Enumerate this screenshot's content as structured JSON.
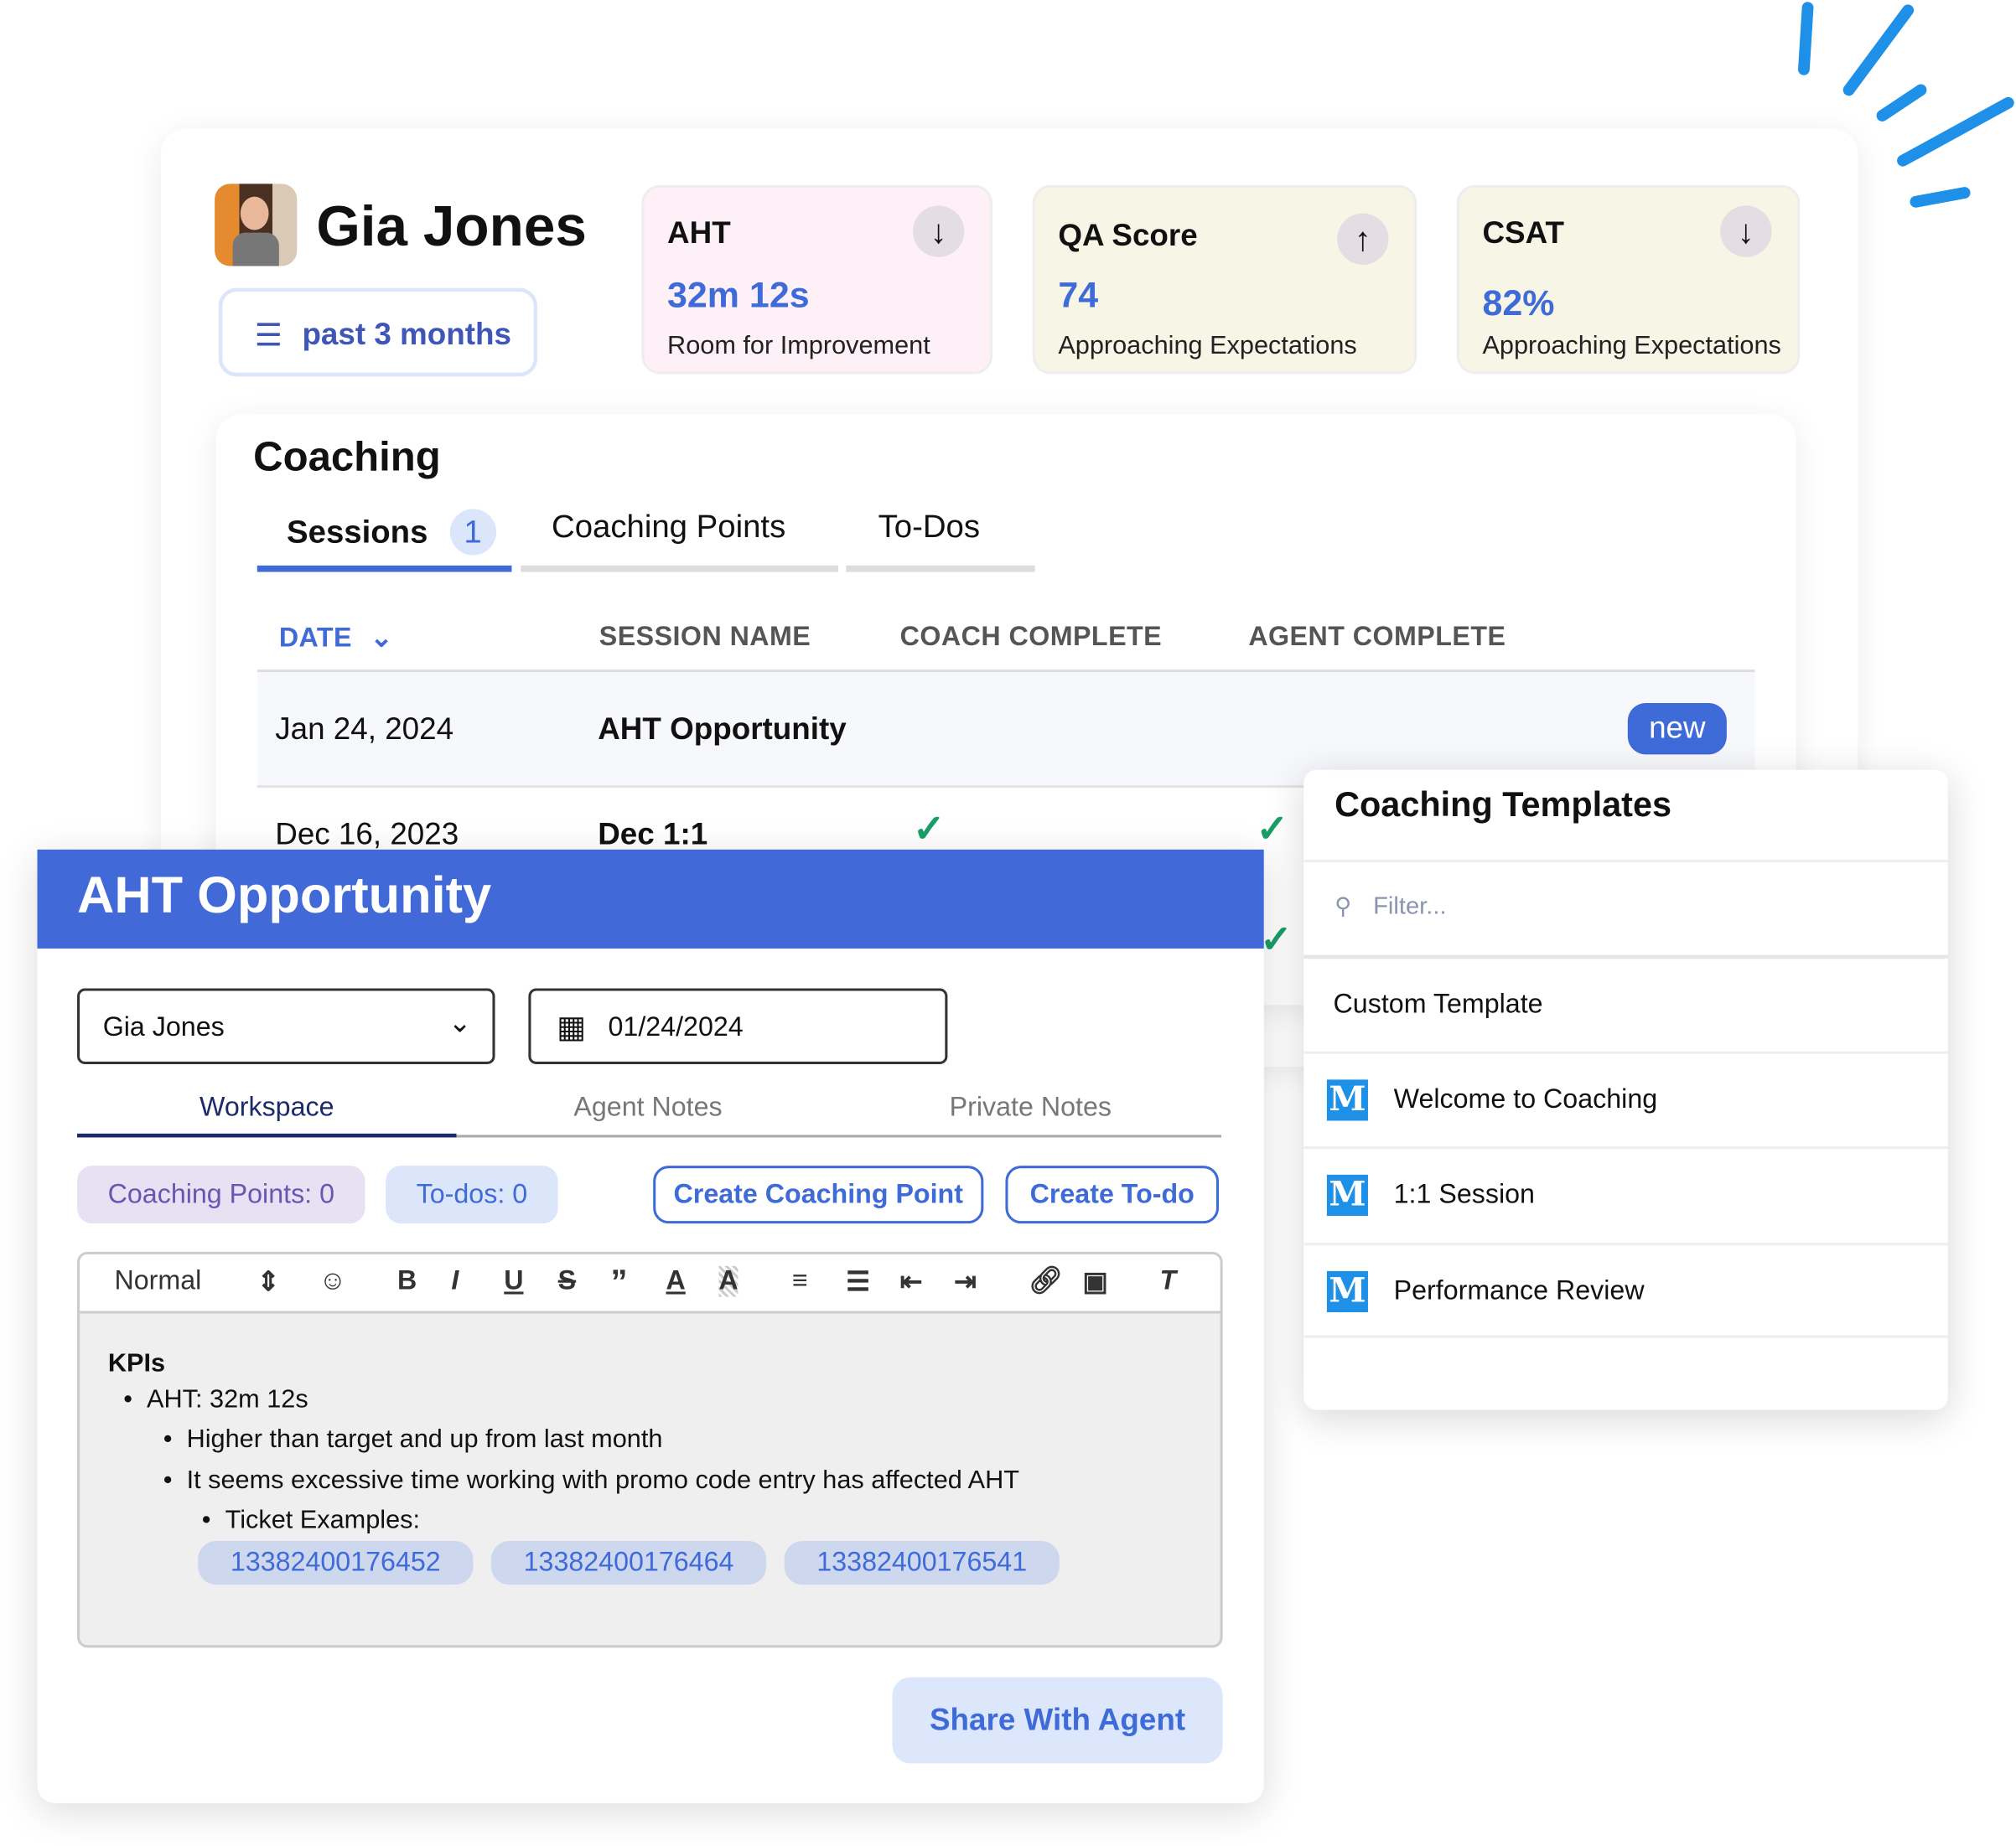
{
  "agent": {
    "name": "Gia Jones",
    "filter_label": "past 3 months"
  },
  "kpis": [
    {
      "label": "AHT",
      "value": "32m 12s",
      "status": "Room for Improvement",
      "trend": "down",
      "bg": "#fdf0f6"
    },
    {
      "label": "QA Score",
      "value": "74",
      "status": "Approaching Expectations",
      "trend": "up",
      "bg": "#f7f6e6"
    },
    {
      "label": "CSAT",
      "value": "82%",
      "status": "Approaching Expectations",
      "trend": "down",
      "bg": "#f7f6e6"
    }
  ],
  "coaching": {
    "title": "Coaching",
    "tabs": [
      {
        "label": "Sessions",
        "badge": "1"
      },
      {
        "label": "Coaching Points"
      },
      {
        "label": "To-Dos"
      }
    ],
    "columns": [
      "DATE",
      "SESSION NAME",
      "COACH COMPLETE",
      "AGENT COMPLETE"
    ],
    "rows": [
      {
        "date": "Jan 24, 2024",
        "name": "AHT Opportunity",
        "badge": "new"
      },
      {
        "date": "Dec 16, 2023",
        "name": "Dec 1:1",
        "coach_complete": true,
        "agent_complete": true
      }
    ]
  },
  "session": {
    "title": "AHT Opportunity",
    "agent_select": "Gia Jones",
    "date": "01/24/2024",
    "tabs": [
      "Workspace",
      "Agent Notes",
      "Private Notes"
    ],
    "coaching_points_chip": "Coaching Points: 0",
    "todos_chip": "To-dos: 0",
    "create_point": "Create Coaching Point",
    "create_todo": "Create To-do",
    "format": "Normal",
    "notes": {
      "heading": "KPIs",
      "l1": "AHT: 32m 12s",
      "l2a": "Higher than target and up from last month",
      "l2b": "It seems excessive time working with promo code entry has affected AHT",
      "l3": "Ticket Examples:",
      "tickets": [
        "13382400176452",
        "13382400176464",
        "13382400176541"
      ]
    },
    "share": "Share With Agent",
    "accent": "#4169d8"
  },
  "templates": {
    "title": "Coaching Templates",
    "filter_placeholder": "Filter...",
    "items": [
      "Custom Template",
      "Welcome to Coaching",
      "1:1 Session",
      "Performance Review"
    ]
  }
}
